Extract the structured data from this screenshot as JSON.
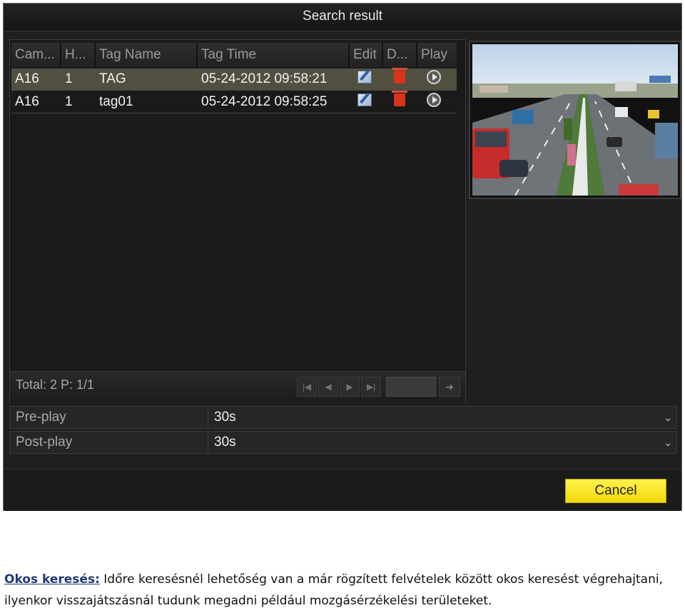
{
  "dialog": {
    "title": "Search result"
  },
  "table": {
    "columns": [
      "Cam...",
      "H...",
      "Tag Name",
      "Tag Time",
      "Edit",
      "D...",
      "Play"
    ],
    "rows": [
      {
        "cam": "A16",
        "h": "1",
        "tag_name": "TAG",
        "tag_time": "05-24-2012 09:58:21",
        "selected": true
      },
      {
        "cam": "A16",
        "h": "1",
        "tag_name": "tag01",
        "tag_time": "05-24-2012 09:58:25",
        "selected": false
      }
    ],
    "row_icons": {
      "edit": "edit-icon",
      "delete": "trash-icon",
      "play": "play-icon"
    }
  },
  "pagination": {
    "total_text": "Total: 2  P: 1/1",
    "buttons": [
      "first-page-icon",
      "prev-page-icon",
      "next-page-icon",
      "last-page-icon"
    ],
    "go_icon": "arrow-right-icon"
  },
  "settings": {
    "preplay": {
      "label": "Pre-play",
      "value": "30s"
    },
    "postplay": {
      "label": "Post-play",
      "value": "30s"
    }
  },
  "actions": {
    "cancel_label": "Cancel"
  },
  "caption": {
    "lead": "Okos keresés:",
    "text": " Időre keresésnél lehetőség van a már rögzített felvételek között okos keresést végrehajtani, ilyenkor visszajátszásnál tudunk megadni például mozgásérzékelési területeket."
  },
  "colors": {
    "accent_button": "#f5e11a",
    "selected_row": "#514f40",
    "background": "#1f1f1f"
  }
}
